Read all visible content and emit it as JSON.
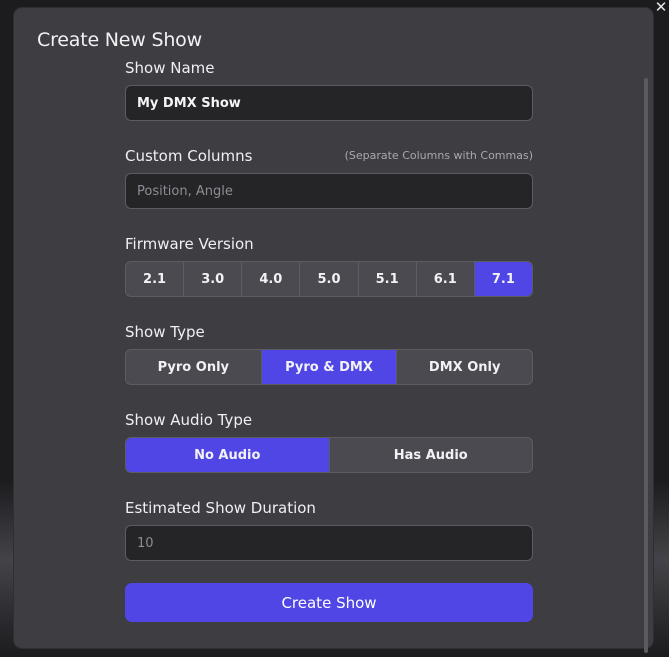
{
  "modal": {
    "title": "Create New Show",
    "close_glyph": "✕"
  },
  "show_name": {
    "label": "Show Name",
    "value": "My DMX Show"
  },
  "custom_columns": {
    "label": "Custom Columns",
    "hint": "(Separate Columns with Commas)",
    "placeholder": "Position, Angle",
    "value": ""
  },
  "firmware": {
    "label": "Firmware Version",
    "options": [
      "2.1",
      "3.0",
      "4.0",
      "5.0",
      "5.1",
      "6.1",
      "7.1"
    ],
    "selected": "7.1"
  },
  "show_type": {
    "label": "Show Type",
    "options": [
      "Pyro Only",
      "Pyro & DMX",
      "DMX Only"
    ],
    "selected": "Pyro & DMX"
  },
  "audio_type": {
    "label": "Show Audio Type",
    "options": [
      "No Audio",
      "Has Audio"
    ],
    "selected": "No Audio"
  },
  "duration": {
    "label": "Estimated Show Duration",
    "placeholder": "10",
    "value": ""
  },
  "submit": {
    "label": "Create Show"
  },
  "colors": {
    "accent": "#4f46e5",
    "modal_bg": "#3d3d42",
    "input_bg": "#252528"
  }
}
